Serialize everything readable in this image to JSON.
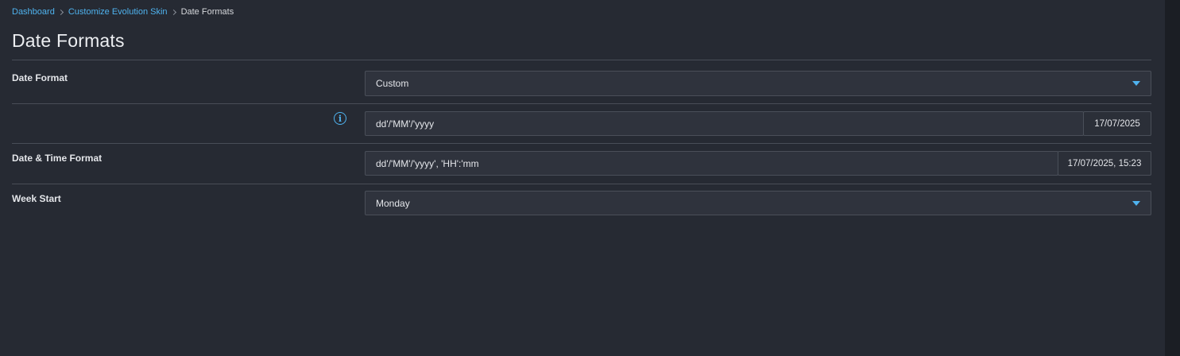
{
  "breadcrumb": {
    "items": [
      "Dashboard",
      "Customize Evolution Skin"
    ],
    "current": "Date Formats"
  },
  "page": {
    "title": "Date Formats"
  },
  "form": {
    "date_format": {
      "label": "Date Format",
      "value": "Custom"
    },
    "custom_format": {
      "value": "dd'/'MM'/'yyyy",
      "preview": "17/07/2025",
      "info_icon": "info-icon"
    },
    "datetime_format": {
      "label": "Date & Time Format",
      "value": "dd'/'MM'/'yyyy', 'HH':'mm",
      "preview": "17/07/2025, 15:23"
    },
    "week_start": {
      "label": "Week Start",
      "value": "Monday"
    }
  },
  "colors": {
    "background": "#262a33",
    "accent": "#4fb3ef",
    "input_bg": "#2f333d",
    "border": "#4a4f59"
  }
}
